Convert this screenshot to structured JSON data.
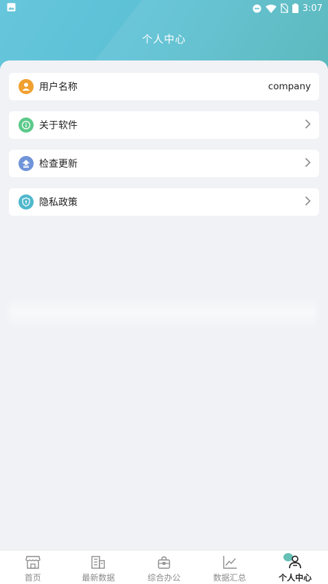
{
  "status_bar": {
    "time": "3:07"
  },
  "header": {
    "title": "个人中心"
  },
  "menu": {
    "username": {
      "label": "用户名称",
      "value": "company"
    },
    "about": {
      "label": "关于软件"
    },
    "update": {
      "label": "检查更新"
    },
    "privacy": {
      "label": "隐私政策"
    }
  },
  "tabs": [
    {
      "label": "首页",
      "icon": "store-icon"
    },
    {
      "label": "最新数据",
      "icon": "building-icon"
    },
    {
      "label": "综合办公",
      "icon": "briefcase-icon"
    },
    {
      "label": "数据汇总",
      "icon": "line-chart-icon"
    },
    {
      "label": "个人中心",
      "icon": "person-icon",
      "active": true
    }
  ],
  "colors": {
    "accent": "#5cc0d4",
    "user_icon": "#f0a030",
    "about_icon": "#5cc98a",
    "update_icon": "#6f94d8",
    "privacy_icon": "#4fb8cc"
  }
}
